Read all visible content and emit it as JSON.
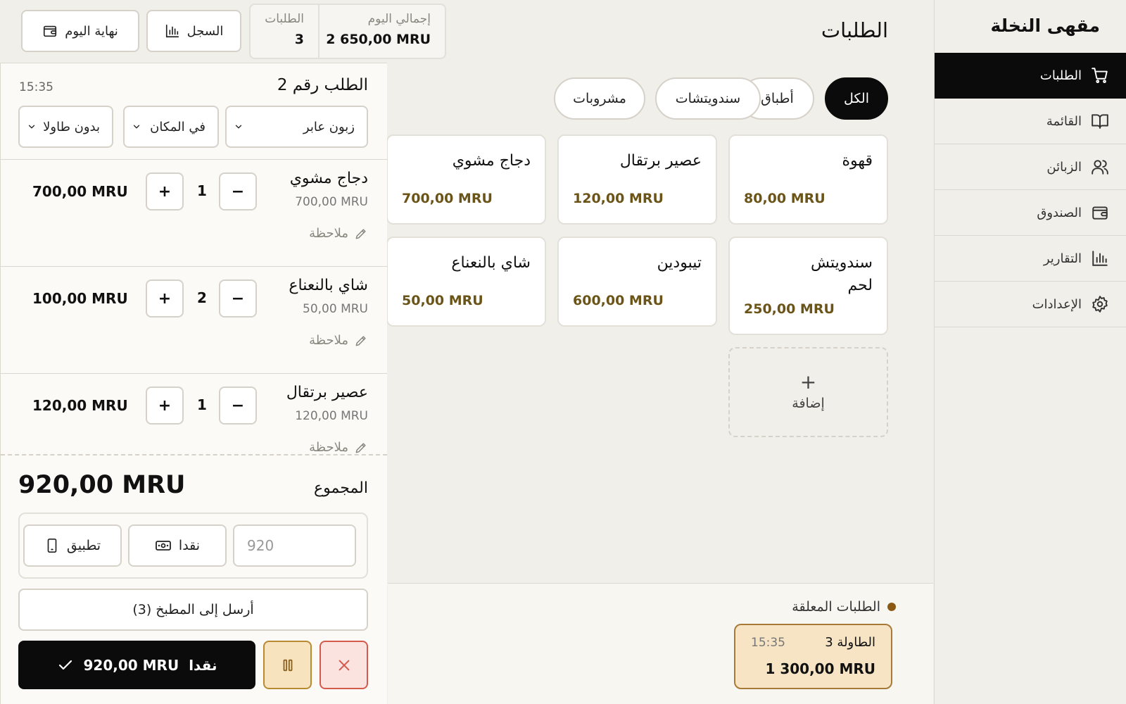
{
  "sidebar": {
    "brand": "مقهى النخلة",
    "items": [
      {
        "label": "الطلبات",
        "icon": "cart-icon",
        "active": true
      },
      {
        "label": "القائمة",
        "icon": "book-icon"
      },
      {
        "label": "الزبائن",
        "icon": "users-icon"
      },
      {
        "label": "الصندوق",
        "icon": "wallet-icon"
      },
      {
        "label": "التقارير",
        "icon": "bar-chart-icon"
      },
      {
        "label": "الإعدادات",
        "icon": "gear-icon"
      }
    ]
  },
  "header": {
    "title": "الطلبات",
    "stats": {
      "total_label": "إجمالي اليوم",
      "total_value": "2 650,00 MRU",
      "orders_label": "الطلبات",
      "orders_value": "3"
    },
    "history_button": {
      "label": "السجل",
      "icon": "bar-chart-icon"
    },
    "end_day_button": {
      "label": "نهاية اليوم",
      "icon": "wallet-icon"
    }
  },
  "order": {
    "title": "الطلب رقم 2",
    "time": "15:35",
    "customer": "زبون عابر",
    "service": "في المكان",
    "table": "بدون طاولا",
    "note_label": "ملاحظة",
    "items": [
      {
        "name": "دجاج مشوي",
        "unit_price": "700,00 MRU",
        "qty": "1",
        "total": "700,00 MRU"
      },
      {
        "name": "شاي بالنعناع",
        "unit_price": "50,00 MRU",
        "qty": "2",
        "total": "100,00 MRU"
      },
      {
        "name": "عصير برتقال",
        "unit_price": "120,00 MRU",
        "qty": "1",
        "total": "120,00 MRU"
      }
    ],
    "sum_label": "المجموع",
    "sum_value": "920,00 MRU",
    "amount_placeholder": "920",
    "pay_cash": "نقدا",
    "pay_app": "تطبيق",
    "kitchen_button": "أرسل إلى المطبخ (3)",
    "checkout_label": "نقدا",
    "checkout_amount": "920,00 MRU"
  },
  "menu": {
    "categories": [
      "الكل",
      "أطباق",
      "سندويتشات",
      "مشروبات"
    ],
    "active_category": "الكل",
    "products": [
      {
        "name": "قهوة",
        "price": "80,00 MRU"
      },
      {
        "name": "عصير برتقال",
        "price": "120,00 MRU"
      },
      {
        "name": "دجاج مشوي",
        "price": "700,00 MRU"
      },
      {
        "name": "سندويتش لحم",
        "price": "250,00 MRU"
      },
      {
        "name": "تيبودين",
        "price": "600,00 MRU"
      },
      {
        "name": "شاي بالنعناع",
        "price": "50,00 MRU"
      }
    ],
    "add_label": "إضافة"
  },
  "pending": {
    "title": "الطلبات المعلقة",
    "orders": [
      {
        "table": "الطاولة 3",
        "time": "15:35",
        "amount": "1 300,00 MRU"
      }
    ]
  },
  "colors": {
    "background": "#f1efe9",
    "panel": "#fbfaf6",
    "accent_dark": "#0b0b0b",
    "price_brown": "#6b5418",
    "pending_fill": "#f6e4c4",
    "pending_border": "#a77a38",
    "cancel_red": "#d45a4c",
    "hold_gold": "#b88b33"
  }
}
